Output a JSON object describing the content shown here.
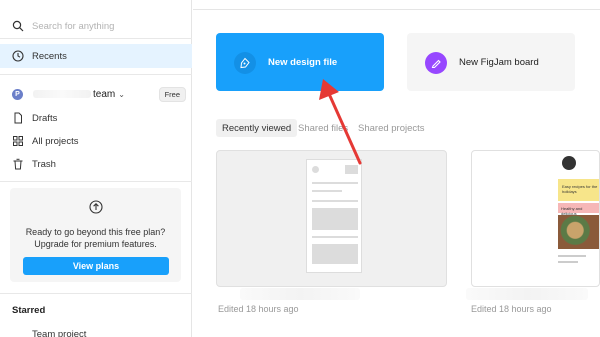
{
  "sidebar": {
    "search_placeholder": "Search for anything",
    "recents": "Recents",
    "team_initial": "P",
    "team_name": "team",
    "team_chevron": "⌄",
    "plan_badge": "Free",
    "drafts": "Drafts",
    "all_projects": "All projects",
    "trash": "Trash",
    "upgrade_text": "Ready to go beyond this free plan? Upgrade for premium features.",
    "view_plans": "View plans",
    "starred": "Starred",
    "team_project": "Team project"
  },
  "main": {
    "new_design_file": "New design file",
    "new_figjam_board": "New FigJam board",
    "tabs": [
      "Recently viewed",
      "Shared files",
      "Shared projects"
    ],
    "files": [
      {
        "edited": "Edited 18 hours ago"
      },
      {
        "edited": "Edited 18 hours ago",
        "thumb_heading": "Easy recipes for the holidays",
        "thumb_sub": "Healthy and delicious"
      }
    ]
  },
  "colors": {
    "accent": "#18a0fb",
    "figjam": "#9747ff",
    "arrow": "#e53935"
  }
}
